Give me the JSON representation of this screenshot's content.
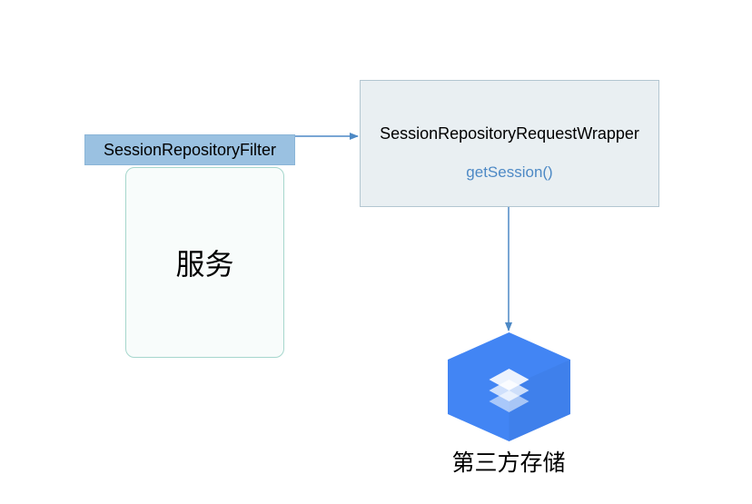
{
  "nodes": {
    "filter": {
      "label": "SessionRepositoryFilter"
    },
    "service": {
      "label": "服务"
    },
    "wrapper": {
      "title": "SessionRepositoryRequestWrapper",
      "method": "getSession()"
    },
    "storage": {
      "label": "第三方存储"
    }
  },
  "colors": {
    "filterBg": "#9ac1e1",
    "serviceBg": "#f8fcfb",
    "serviceBorder": "#a6d7cd",
    "wrapperBg": "#e9eff2",
    "wrapperBorder": "#b3c6d1",
    "arrowColor": "#4d89c5",
    "methodColor": "#4d89c5",
    "hexagonColor": "#4285F4"
  }
}
